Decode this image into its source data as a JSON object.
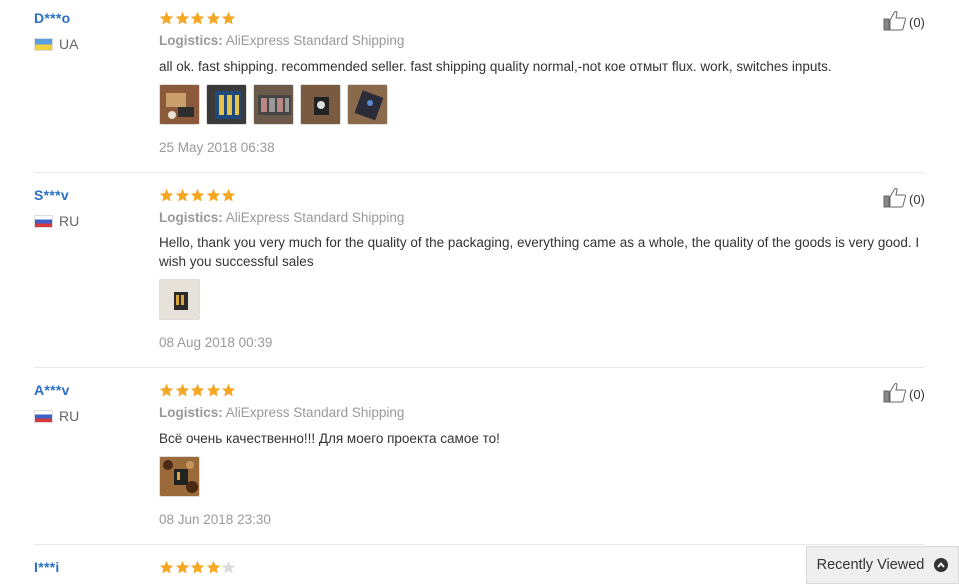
{
  "reviews": [
    {
      "user": "D***o",
      "country": "UA",
      "rating": 5,
      "logistics_label": "Logistics:",
      "logistics_value": "AliExpress Standard Shipping",
      "text": "all ok. fast shipping. recommended seller. fast shipping quality normal,-not кое отмыт flux. work, switches inputs.",
      "photo_count": 5,
      "date": "25 May 2018 06:38",
      "useful_count": "(0)"
    },
    {
      "user": "S***v",
      "country": "RU",
      "rating": 5,
      "logistics_label": "Logistics:",
      "logistics_value": "AliExpress Standard Shipping",
      "text": "Hello, thank you very much for the quality of the packaging, everything came as a whole, the quality of the goods is very good. I wish you successful sales",
      "photo_count": 1,
      "date": "08 Aug 2018 00:39",
      "useful_count": "(0)"
    },
    {
      "user": "A***v",
      "country": "RU",
      "rating": 5,
      "logistics_label": "Logistics:",
      "logistics_value": "AliExpress Standard Shipping",
      "text": "Всё очень качественно!!! Для моего проекта самое то!",
      "photo_count": 1,
      "date": "08 Jun 2018 23:30",
      "useful_count": "(0)"
    },
    {
      "user": "I***i",
      "rating": 4
    }
  ],
  "recently_viewed": {
    "label": "Recently Viewed",
    "icon": "chevron-up-icon"
  },
  "colors": {
    "star_on": "#f5a623",
    "star_off": "#dddddd",
    "name": "#2a6fc4"
  }
}
